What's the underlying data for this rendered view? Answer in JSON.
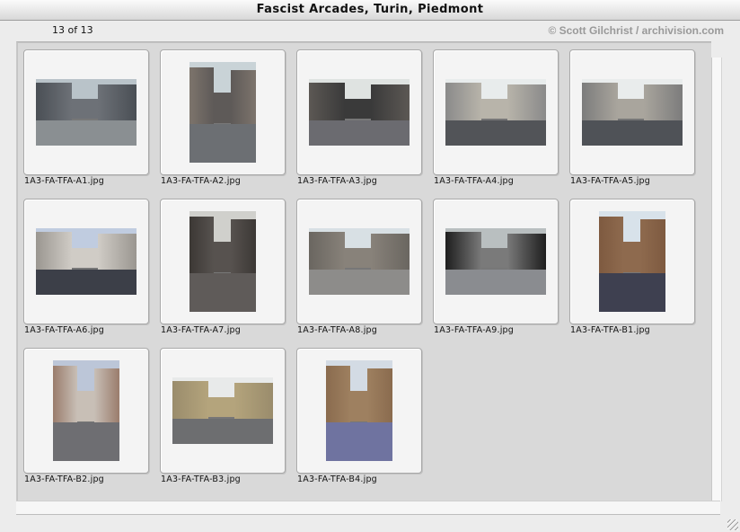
{
  "window": {
    "title": "Fascist Arcades, Turin, Piedmont"
  },
  "header": {
    "counter": "13 of 13",
    "copyright": "© Scott Gilchrist / archivision.com"
  },
  "gallery": {
    "items": [
      {
        "filename": "1A3-FA-TFA-A1.jpg",
        "orientation": "landscape"
      },
      {
        "filename": "1A3-FA-TFA-A2.jpg",
        "orientation": "portrait"
      },
      {
        "filename": "1A3-FA-TFA-A3.jpg",
        "orientation": "landscape"
      },
      {
        "filename": "1A3-FA-TFA-A4.jpg",
        "orientation": "landscape"
      },
      {
        "filename": "1A3-FA-TFA-A5.jpg",
        "orientation": "landscape"
      },
      {
        "filename": "1A3-FA-TFA-A6.jpg",
        "orientation": "landscape"
      },
      {
        "filename": "1A3-FA-TFA-A7.jpg",
        "orientation": "portrait"
      },
      {
        "filename": "1A3-FA-TFA-A8.jpg",
        "orientation": "landscape"
      },
      {
        "filename": "1A3-FA-TFA-A9.jpg",
        "orientation": "landscape"
      },
      {
        "filename": "1A3-FA-TFA-B1.jpg",
        "orientation": "portrait"
      },
      {
        "filename": "1A3-FA-TFA-B2.jpg",
        "orientation": "portrait"
      },
      {
        "filename": "1A3-FA-TFA-B3.jpg",
        "orientation": "landscape"
      },
      {
        "filename": "1A3-FA-TFA-B4.jpg",
        "orientation": "portrait"
      }
    ]
  },
  "colors": {
    "window_bg": "#ececec",
    "panel_bg": "#d9d9d9",
    "slide_bg": "#f4f4f4",
    "copyright_text": "#999999"
  }
}
